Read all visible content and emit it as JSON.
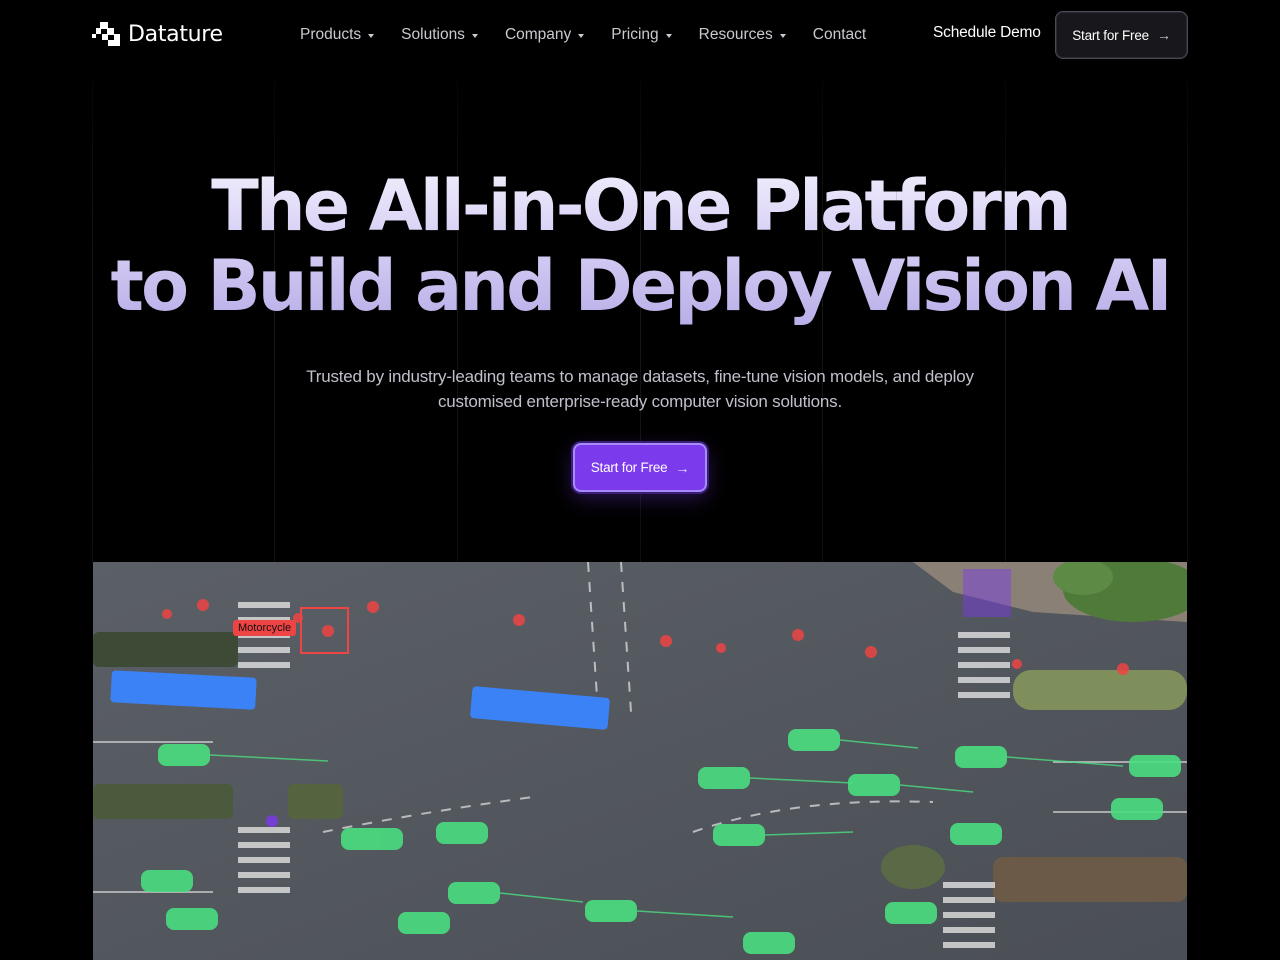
{
  "brand": {
    "name": "Datature"
  },
  "nav": {
    "items": [
      {
        "label": "Products",
        "has_dropdown": true
      },
      {
        "label": "Solutions",
        "has_dropdown": true
      },
      {
        "label": "Company",
        "has_dropdown": true
      },
      {
        "label": "Pricing",
        "has_dropdown": true
      },
      {
        "label": "Resources",
        "has_dropdown": true
      },
      {
        "label": "Contact",
        "has_dropdown": false
      }
    ],
    "schedule_demo": "Schedule Demo",
    "cta": "Start for Free"
  },
  "hero": {
    "title_line1": "The All-in-One Platform",
    "title_line2": "to Build and Deploy Vision AI",
    "subtitle": "Trusted by industry-leading teams to manage datasets, fine-tune vision models,  and deploy customised enterprise-ready computer vision solutions.",
    "cta": "Start for Free"
  },
  "media": {
    "detection_label": "Motorcycle"
  },
  "colors": {
    "background": "#000000",
    "primary": "#7c3aed",
    "detection_car": "#4ade80",
    "detection_bus": "#3b82f6",
    "detection_motorcycle": "#ef4444",
    "detection_other": "#7c3aed"
  }
}
